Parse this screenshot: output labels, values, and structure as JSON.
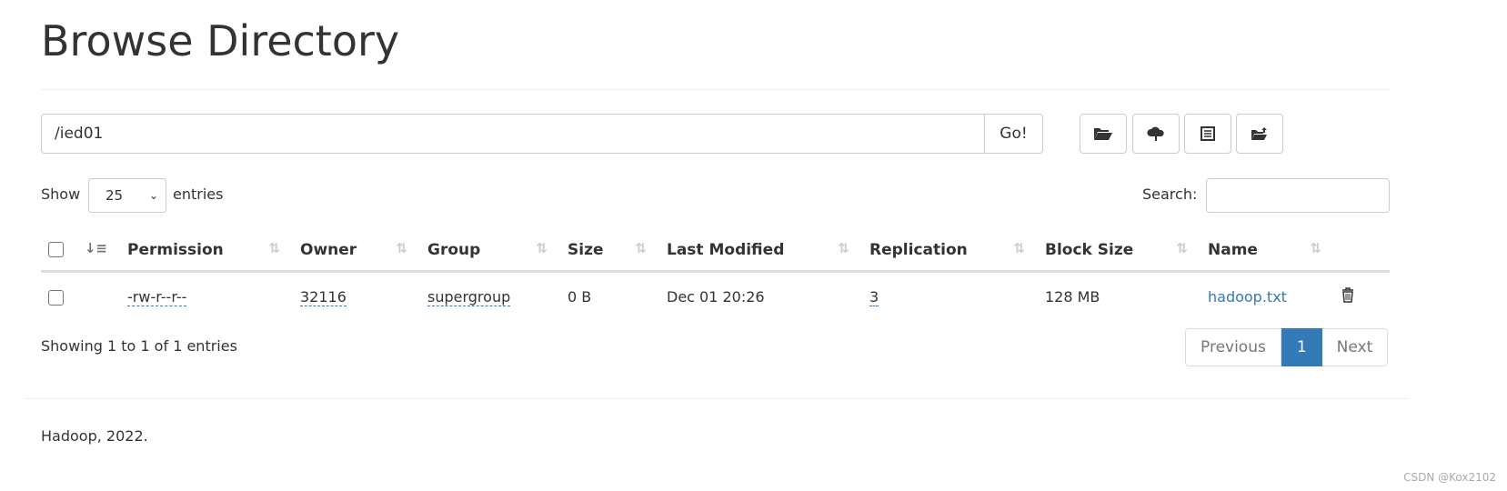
{
  "title": "Browse Directory",
  "path": {
    "value": "/ied01",
    "go_label": "Go!"
  },
  "toolbar": [
    {
      "icon": "folder-open-icon"
    },
    {
      "icon": "cloud-upload-icon"
    },
    {
      "icon": "list-alt-icon"
    },
    {
      "icon": "folder-arrow-icon"
    }
  ],
  "length": {
    "show": "Show",
    "value": "25",
    "entries": "entries"
  },
  "search": {
    "label": "Search:",
    "value": ""
  },
  "columns": [
    "Permission",
    "Owner",
    "Group",
    "Size",
    "Last Modified",
    "Replication",
    "Block Size",
    "Name"
  ],
  "rows": [
    {
      "permission": "-rw-r--r--",
      "owner": "32116",
      "group": "supergroup",
      "size": "0 B",
      "modified": "Dec 01 20:26",
      "replication": "3",
      "block_size": "128 MB",
      "name": "hadoop.txt"
    }
  ],
  "info": "Showing 1 to 1 of 1 entries",
  "pagination": {
    "previous": "Previous",
    "current": "1",
    "next": "Next"
  },
  "footer": "Hadoop, 2022.",
  "watermark": "CSDN @Kox2102"
}
